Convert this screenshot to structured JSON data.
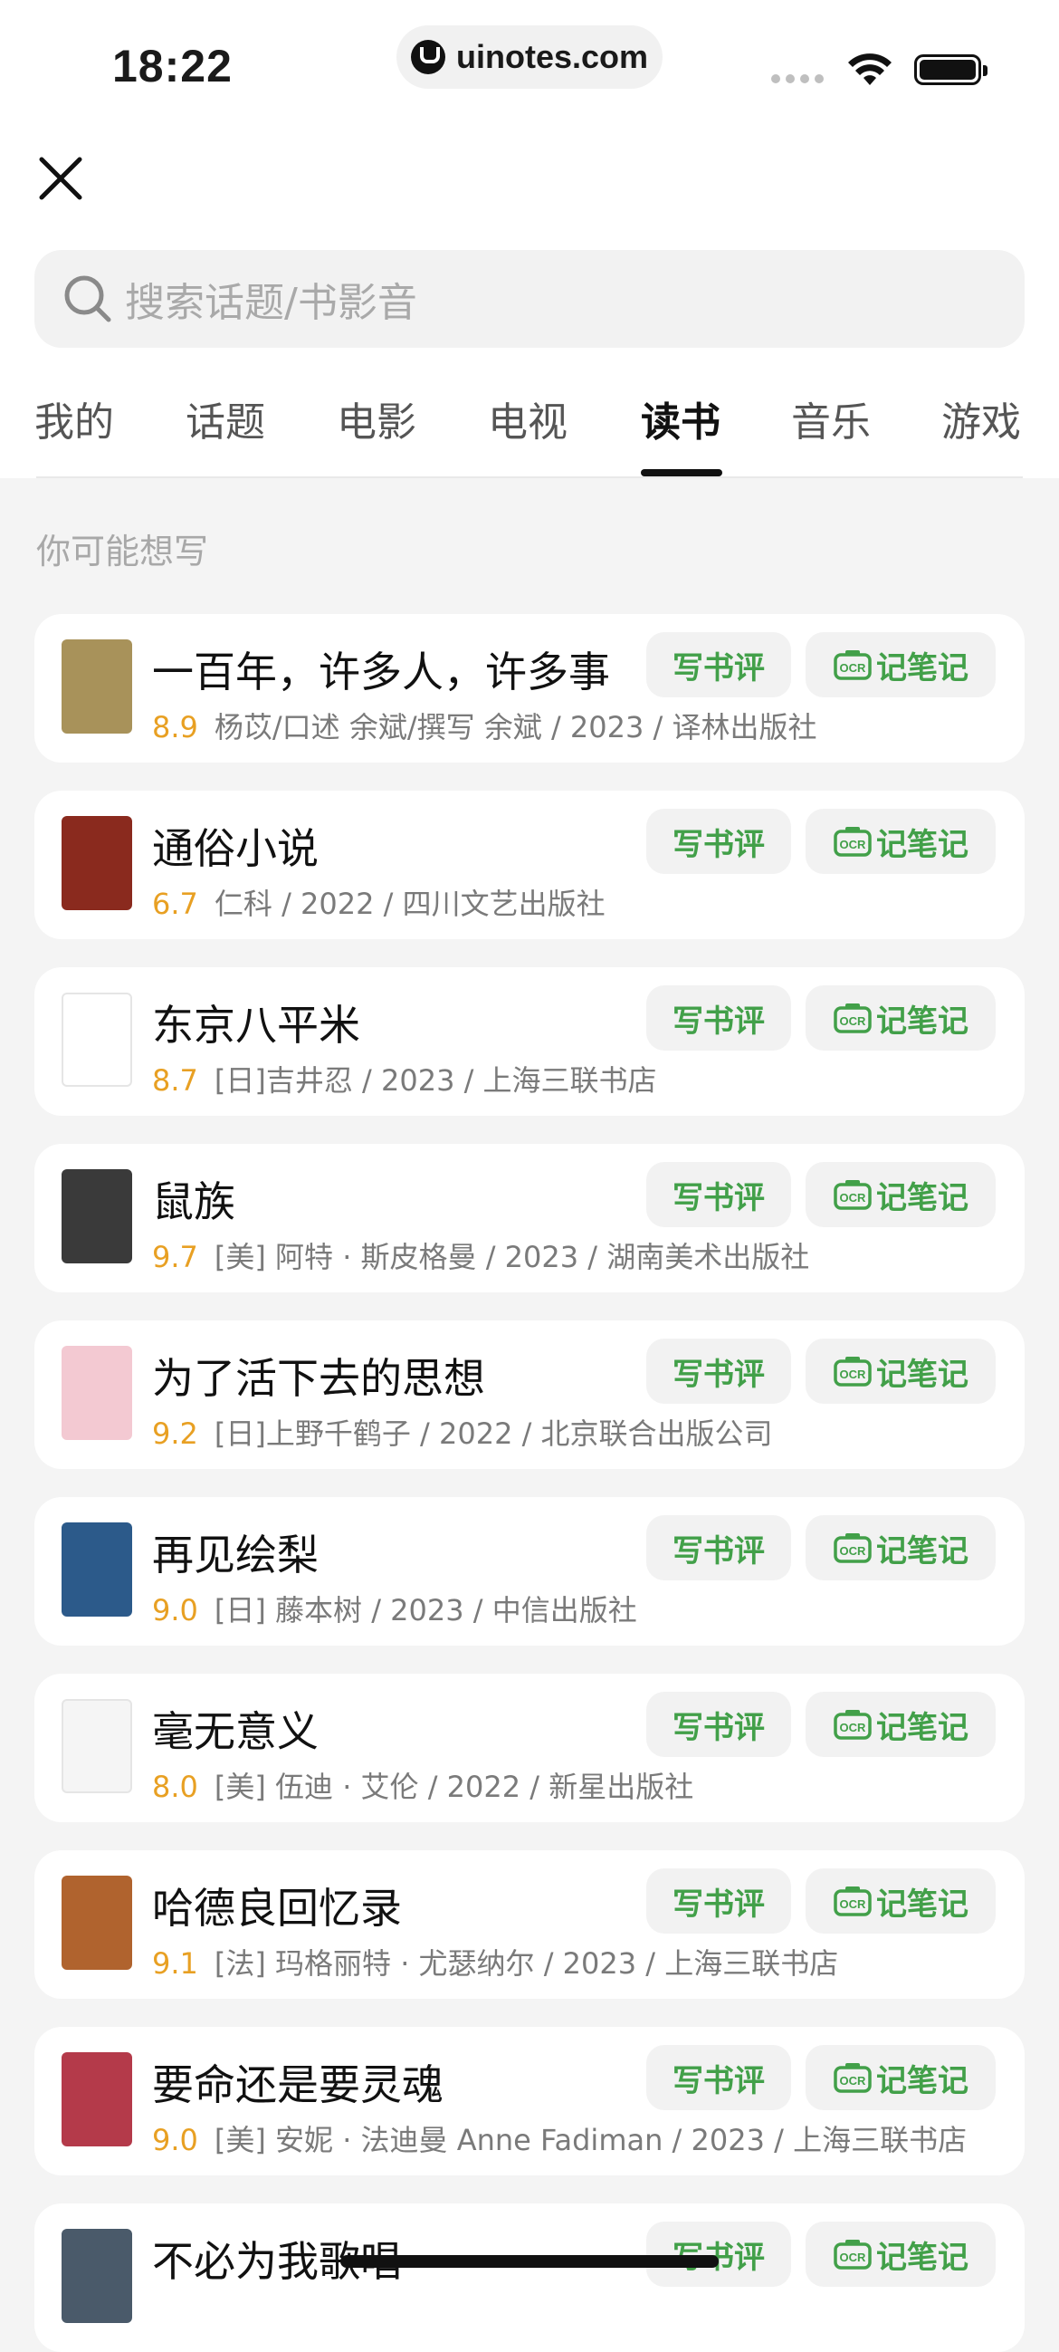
{
  "status_bar": {
    "time": "18:22",
    "url": "uinotes.com"
  },
  "search": {
    "placeholder": "搜索话题/书影音"
  },
  "tabs": [
    "我的",
    "话题",
    "电影",
    "电视",
    "读书",
    "音乐",
    "游戏"
  ],
  "active_tab": "读书",
  "section_title": "你可能想写",
  "buttons": {
    "review": "写书评",
    "note": "记笔记"
  },
  "books": [
    {
      "title": "一百年，许多人，许多事",
      "score": "8.9",
      "meta": "杨苡/口述 余斌/撰写 余斌 / 2023 / 译林出版社",
      "cover_color": "#a8925a"
    },
    {
      "title": "通俗小说",
      "score": "6.7",
      "meta": "仁科 / 2022 / 四川文艺出版社",
      "cover_color": "#8a2a1e"
    },
    {
      "title": "东京八平米",
      "score": "8.7",
      "meta": "[日]吉井忍 / 2023 / 上海三联书店",
      "cover_color": "#ffffff"
    },
    {
      "title": "鼠族",
      "score": "9.7",
      "meta": "[美] 阿特 · 斯皮格曼 / 2023 / 湖南美术出版社",
      "cover_color": "#3a3a3a"
    },
    {
      "title": "为了活下去的思想",
      "score": "9.2",
      "meta": "[日]上野千鹤子 / 2022 / 北京联合出版公司",
      "cover_color": "#f3c9d2"
    },
    {
      "title": "再见绘梨",
      "score": "9.0",
      "meta": "[日] 藤本树 / 2023 / 中信出版社",
      "cover_color": "#2c5a8a"
    },
    {
      "title": "毫无意义",
      "score": "8.0",
      "meta": "[美] 伍迪 · 艾伦 / 2022 / 新星出版社",
      "cover_color": "#f5f5f5"
    },
    {
      "title": "哈德良回忆录",
      "score": "9.1",
      "meta": "[法] 玛格丽特 · 尤瑟纳尔 / 2023 / 上海三联书店",
      "cover_color": "#b0632e"
    },
    {
      "title": "要命还是要灵魂",
      "score": "9.0",
      "meta": "[美] 安妮 · 法迪曼 Anne Fadiman / 2023 / 上海三联书店",
      "cover_color": "#b43a4a"
    },
    {
      "title": "不必为我歌唱",
      "score": "",
      "meta": "",
      "cover_color": "#4a5a6a"
    }
  ],
  "colors": {
    "accent_green": "#42a049",
    "score_orange": "#e8a023"
  }
}
